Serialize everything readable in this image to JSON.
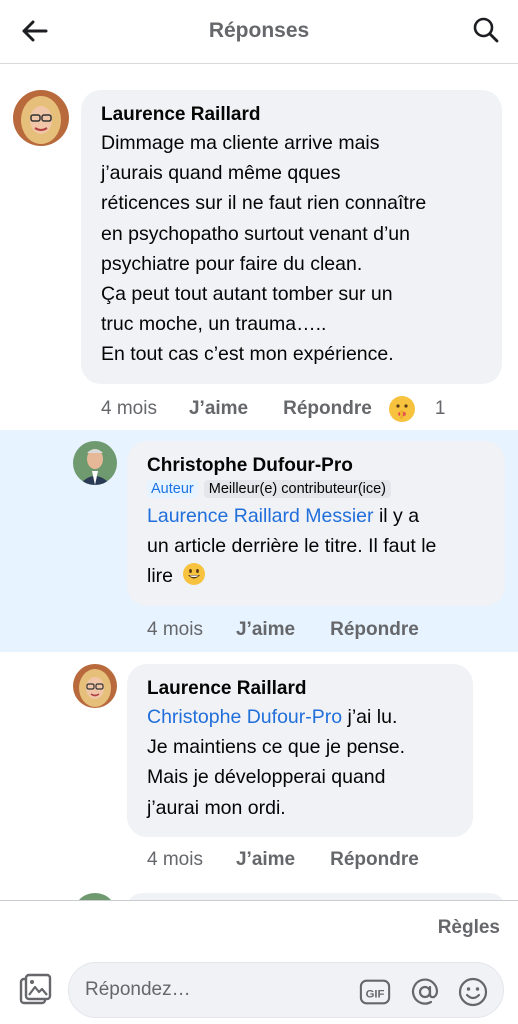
{
  "header": {
    "title": "Réponses"
  },
  "comments": [
    {
      "author": "Laurence Raillard",
      "lines": [
        "Dimmage ma cliente arrive mais",
        "j’aurais quand même qques",
        "réticences sur il ne faut rien connaître",
        "en psychopatho surtout venant d’un",
        "psychiatre pour faire du clean.",
        "Ça peut tout autant tomber sur un",
        "truc moche, un trauma…..",
        "En tout cas c’est mon expérience."
      ],
      "time": "4 mois",
      "like": "J’aime",
      "reply": "Répondre",
      "reaction_count": "1"
    },
    {
      "author": "Christophe Dufour-Pro",
      "badge_author": "Auteur",
      "badge_top": "Meilleur(e) contributeur(ice)",
      "mention": "Laurence Raillard Messier",
      "line1_rest": " il y a",
      "line2": "un article derrière le titre. Il faut le",
      "line3": "lire",
      "time": "4 mois",
      "like": "J’aime",
      "reply": "Répondre"
    },
    {
      "author": "Laurence Raillard",
      "mention": "Christophe Dufour-Pro",
      "line1_rest": " j’ai lu.",
      "line2": "Je maintiens ce que je pense.",
      "line3": "Mais je développerai quand",
      "line4": "j’aurai mon ordi.",
      "time": "4 mois",
      "like": "J’aime",
      "reply": "Répondre"
    }
  ],
  "footer": {
    "rules": "Règles",
    "placeholder": "Répondez…",
    "gif": "GIF"
  },
  "colors": {
    "mention": "#216fdb",
    "highlight": "#e7f3ff",
    "bubble": "#f0f2f5"
  }
}
